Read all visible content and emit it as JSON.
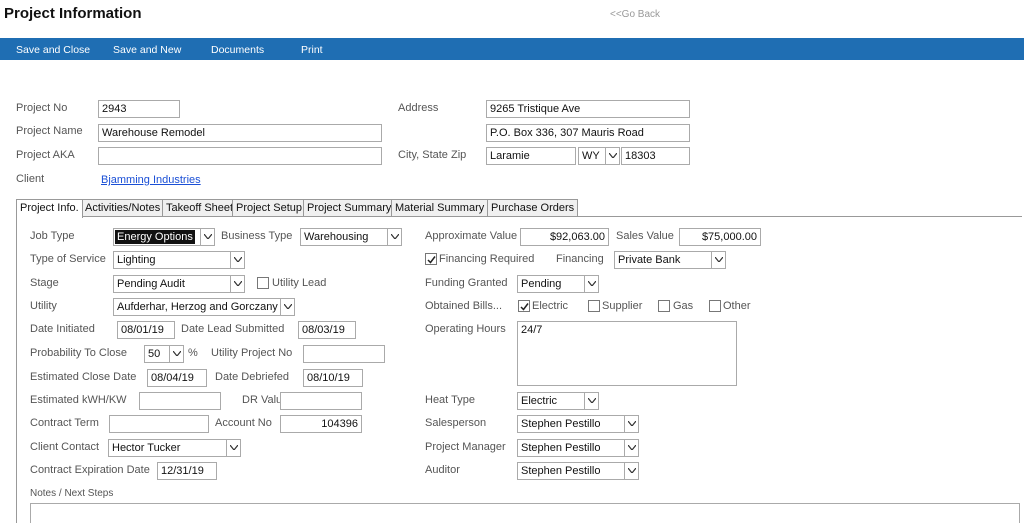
{
  "page": {
    "title": "Project Information",
    "go_back": "<<Go Back"
  },
  "toolbar": {
    "save_close": "Save and Close",
    "save_new": "Save and New",
    "documents": "Documents",
    "print": "Print"
  },
  "header": {
    "project_no_label": "Project No",
    "project_no": "2943",
    "project_name_label": "Project Name",
    "project_name": "Warehouse Remodel",
    "project_aka_label": "Project AKA",
    "project_aka": "",
    "client_label": "Client",
    "client": "Bjamming Industries",
    "address_label": "Address",
    "address1": "9265 Tristique Ave",
    "address2": "P.O. Box 336, 307 Mauris Road",
    "city_label": "City, State Zip",
    "city": "Laramie",
    "state": "WY",
    "zip": "18303"
  },
  "tabs": [
    "Project Info.",
    "Activities/Notes",
    "Takeoff Sheet",
    "Project Setup",
    "Project Summary",
    "Material Summary",
    "Purchase Orders"
  ],
  "form": {
    "job_type_label": "Job Type",
    "job_type": "Energy Options",
    "business_type_label": "Business Type",
    "business_type": "Warehousing",
    "type_of_service_label": "Type of Service",
    "type_of_service": "Lighting",
    "stage_label": "Stage",
    "stage": "Pending Audit",
    "utility_lead_label": "Utility Lead",
    "utility_label": "Utility",
    "utility": "Aufderhar, Herzog and Gorczany",
    "date_initiated_label": "Date Initiated",
    "date_initiated": "08/01/19",
    "date_lead_submitted_label": "Date Lead Submitted",
    "date_lead_submitted": "08/03/19",
    "probability_label": "Probability To Close",
    "probability": "50",
    "percent": "%",
    "utility_project_no_label": "Utility Project No",
    "utility_project_no": "",
    "est_close_label": "Estimated Close Date",
    "est_close": "08/04/19",
    "date_debriefed_label": "Date Debriefed",
    "date_debriefed": "08/10/19",
    "est_kwh_label": "Estimated kWH/KW",
    "est_kwh": "",
    "dr_value_label": "DR Value",
    "dr_value": "",
    "contract_term_label": "Contract Term",
    "contract_term": "",
    "account_no_label": "Account No",
    "account_no": "104396",
    "client_contact_label": "Client Contact",
    "client_contact": "Hector Tucker",
    "contract_exp_label": "Contract Expiration Date",
    "contract_exp": "12/31/19",
    "notes_label": "Notes / Next Steps",
    "approx_value_label": "Approximate Value",
    "approx_value": "$92,063.00",
    "sales_value_label": "Sales Value",
    "sales_value": "$75,000.00",
    "financing_required_label": "Financing Required",
    "financing_label": "Financing",
    "financing": "Private Bank",
    "funding_granted_label": "Funding Granted",
    "funding_granted": "Pending",
    "obtained_bills_label": "Obtained Bills...",
    "bills_electric": "Electric",
    "bills_supplier": "Supplier",
    "bills_gas": "Gas",
    "bills_other": "Other",
    "operating_hours_label": "Operating Hours",
    "operating_hours": "24/7",
    "heat_type_label": "Heat Type",
    "heat_type": "Electric",
    "salesperson_label": "Salesperson",
    "salesperson": "Stephen Pestillo",
    "project_manager_label": "Project Manager",
    "project_manager": "Stephen Pestillo",
    "auditor_label": "Auditor",
    "auditor": "Stephen Pestillo"
  }
}
